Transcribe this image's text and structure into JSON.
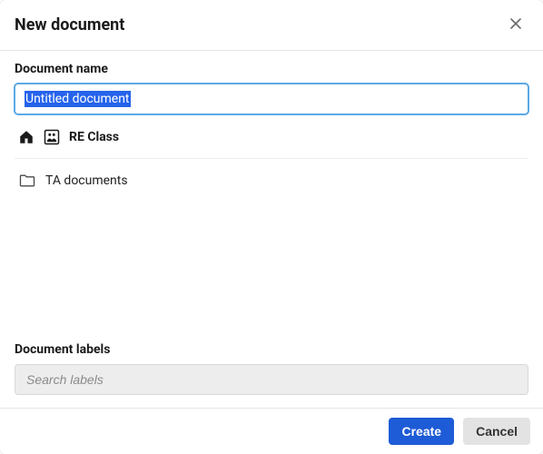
{
  "dialog": {
    "title": "New document"
  },
  "name_section": {
    "label": "Document name",
    "value": "Untitled document"
  },
  "breadcrumb": {
    "class_name": "RE Class"
  },
  "folders": [
    {
      "name": "TA documents"
    }
  ],
  "labels_section": {
    "label": "Document labels",
    "placeholder": "Search labels"
  },
  "footer": {
    "create": "Create",
    "cancel": "Cancel"
  }
}
